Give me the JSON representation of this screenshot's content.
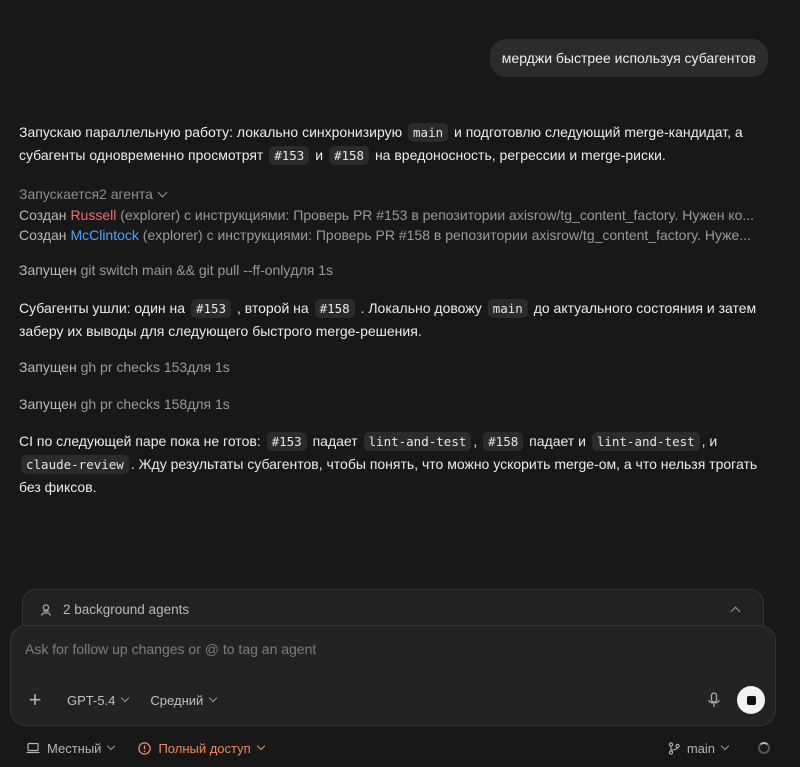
{
  "user_message": "мерджи быстрее используя субагентов",
  "para1": {
    "t1": "Запускаю параллельную работу: локально синхронизирую",
    "code1": "main",
    "t2": "и подготовлю следующий merge-кандидат, а субагенты одновременно просмотрят",
    "code2": "#153",
    "t3": "и",
    "code3": "#158",
    "t4": "на вредоносность, регрессии и merge-риски."
  },
  "agents_toggle": "Запускается2 агента",
  "agents": [
    {
      "verb": "Создан",
      "name": "Russell",
      "rest": "(explorer) с инструкциями: Проверь PR #153 в репозитории axisrow/tg_content_factory. Нужен ко..."
    },
    {
      "verb": "Создан",
      "name": "McClintock",
      "rest": "(explorer) с инструкциями: Проверь PR #158 в репозитории axisrow/tg_content_factory. Нуже..."
    }
  ],
  "tool1": {
    "verb": "Запущен",
    "cmd": "git switch main && git pull --ff-onlyдля 1s"
  },
  "para2": {
    "t1": "Субагенты ушли: один на",
    "code1": "#153",
    "t2": ", второй на",
    "code2": "#158",
    "t3": ". Локально довожу",
    "code3": "main",
    "t4": "до актуального состояния и затем заберу их выводы для следующего быстрого merge-решения."
  },
  "tool2": {
    "verb": "Запущен",
    "cmd": "gh pr checks 153для 1s"
  },
  "tool3": {
    "verb": "Запущен",
    "cmd": "gh pr checks 158для 1s"
  },
  "para3": {
    "t1": "CI по следующей паре пока не готов:",
    "code1": "#153",
    "t2": "падает",
    "code2": "lint-and-test",
    "t3": ",",
    "code3": "#158",
    "t4": "падает и",
    "code4": "lint-and-test",
    "t5": ", и",
    "code5": "claude-review",
    "t6": ". Жду результаты субагентов, чтобы понять, что можно ускорить merge-ом, а что нельзя трогать без фиксов."
  },
  "bg_agents_label": "2 background agents",
  "composer": {
    "placeholder": "Ask for follow up changes or @ to tag an agent",
    "model": "GPT-5.4",
    "effort": "Средний"
  },
  "footer": {
    "env": "Местный",
    "access": "Полный доступ",
    "branch": "main"
  },
  "colors": {
    "agent1": "#f07070",
    "agent2": "#4aa3ff",
    "warning": "#f08a5c"
  }
}
